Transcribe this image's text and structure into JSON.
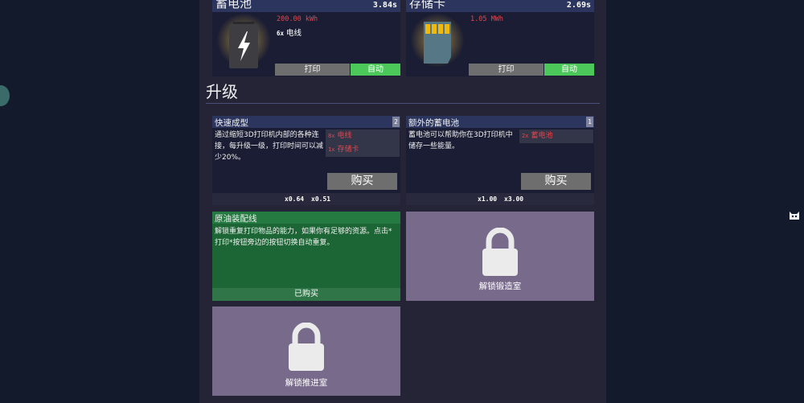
{
  "producers": [
    {
      "name": "蓄电池",
      "time": "3.84s",
      "stat": "200.00 kWh",
      "req_qty": "6x",
      "req_name": "电线",
      "print": "打印",
      "auto": "自动"
    },
    {
      "name": "存储卡",
      "time": "2.69s",
      "stat": "1.05 MWh",
      "print": "打印",
      "auto": "自动"
    }
  ],
  "upgrades_title": "升级",
  "upgrades": [
    {
      "title": "快速成型",
      "level": "2",
      "desc": "通过缩短3D打印机内部的各种连接，每升级一级，打印时间可以减少20%。",
      "costs": [
        {
          "qty": "8x",
          "name": "电线"
        },
        {
          "qty": "1x",
          "name": "存储卡"
        }
      ],
      "buy": "购买",
      "mult_a": "x0.64",
      "mult_b": "x0.51"
    },
    {
      "title": "额外的蓄电池",
      "level": "1",
      "desc": "蓄电池可以帮助你在3D打印机中储存一些能量。",
      "costs": [
        {
          "qty": "2x",
          "name": "蓄电池"
        }
      ],
      "buy": "购买",
      "mult_a": "x1.00",
      "mult_b": "x3.00"
    }
  ],
  "purchased": {
    "title": "原油装配线",
    "desc": "解锁重复打印物品的能力，如果你有足够的资源。点击*打印*按钮旁边的按钮切换自动重复。",
    "status": "已购买"
  },
  "locked": [
    {
      "label": "解锁锻造室"
    },
    {
      "label": "解锁推进室"
    }
  ],
  "colors": {
    "accent_red": "#e2474e",
    "auto_green": "#4cc85b",
    "header_blue": "#2c355d",
    "locked_purple": "#776a8a",
    "bought_green": "#1c6535"
  },
  "icons": [
    "lightning-icon",
    "memory-card-icon",
    "lock-icon",
    "cat-icon"
  ]
}
